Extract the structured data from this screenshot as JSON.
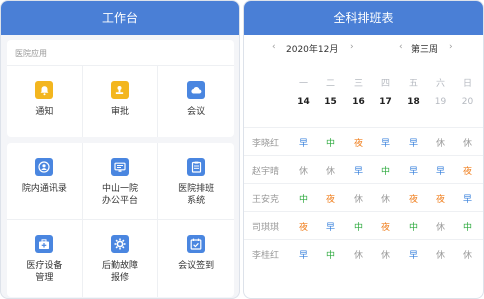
{
  "left": {
    "title": "工作台",
    "section_label": "医院应用",
    "apps_top": [
      {
        "label": "通知",
        "icon": "bell-icon",
        "color": "#f3b61f"
      },
      {
        "label": "审批",
        "icon": "stamp-icon",
        "color": "#f3b61f"
      },
      {
        "label": "会议",
        "icon": "cloud-icon",
        "color": "#4a86e0"
      }
    ],
    "apps_bottom": [
      {
        "label": "院内通讯录",
        "icon": "contacts-icon"
      },
      {
        "label": "中山一院\n办公平台",
        "icon": "monitor-icon"
      },
      {
        "label": "医院排班\n系统",
        "icon": "clipboard-icon"
      },
      {
        "label": "医疗设备\n管理",
        "icon": "medkit-icon"
      },
      {
        "label": "后勤故障\n报修",
        "icon": "gear-icon"
      },
      {
        "label": "会议签到",
        "icon": "checkin-icon"
      }
    ]
  },
  "right": {
    "title": "全科排班表",
    "month": "2020年12月",
    "week": "第三周",
    "weekdays": [
      "一",
      "二",
      "三",
      "四",
      "五",
      "六",
      "日"
    ],
    "dates": [
      "14",
      "15",
      "16",
      "17",
      "18",
      "19",
      "20"
    ],
    "shift_colors": {
      "早": "#3a82dc",
      "中": "#2eaa3f",
      "夜": "#f07f1e",
      "休": "#999999"
    },
    "rows": [
      {
        "name": "李晓红",
        "shifts": [
          "早",
          "中",
          "夜",
          "早",
          "早",
          "休",
          "休"
        ]
      },
      {
        "name": "赵宇晴",
        "shifts": [
          "休",
          "休",
          "早",
          "中",
          "早",
          "早",
          "夜"
        ]
      },
      {
        "name": "王安克",
        "shifts": [
          "中",
          "夜",
          "休",
          "休",
          "夜",
          "夜",
          "早"
        ]
      },
      {
        "name": "司琪琪",
        "shifts": [
          "夜",
          "早",
          "中",
          "夜",
          "中",
          "休",
          "中"
        ]
      },
      {
        "name": "李桂红",
        "shifts": [
          "早",
          "中",
          "休",
          "休",
          "早",
          "休",
          "休"
        ]
      }
    ]
  }
}
